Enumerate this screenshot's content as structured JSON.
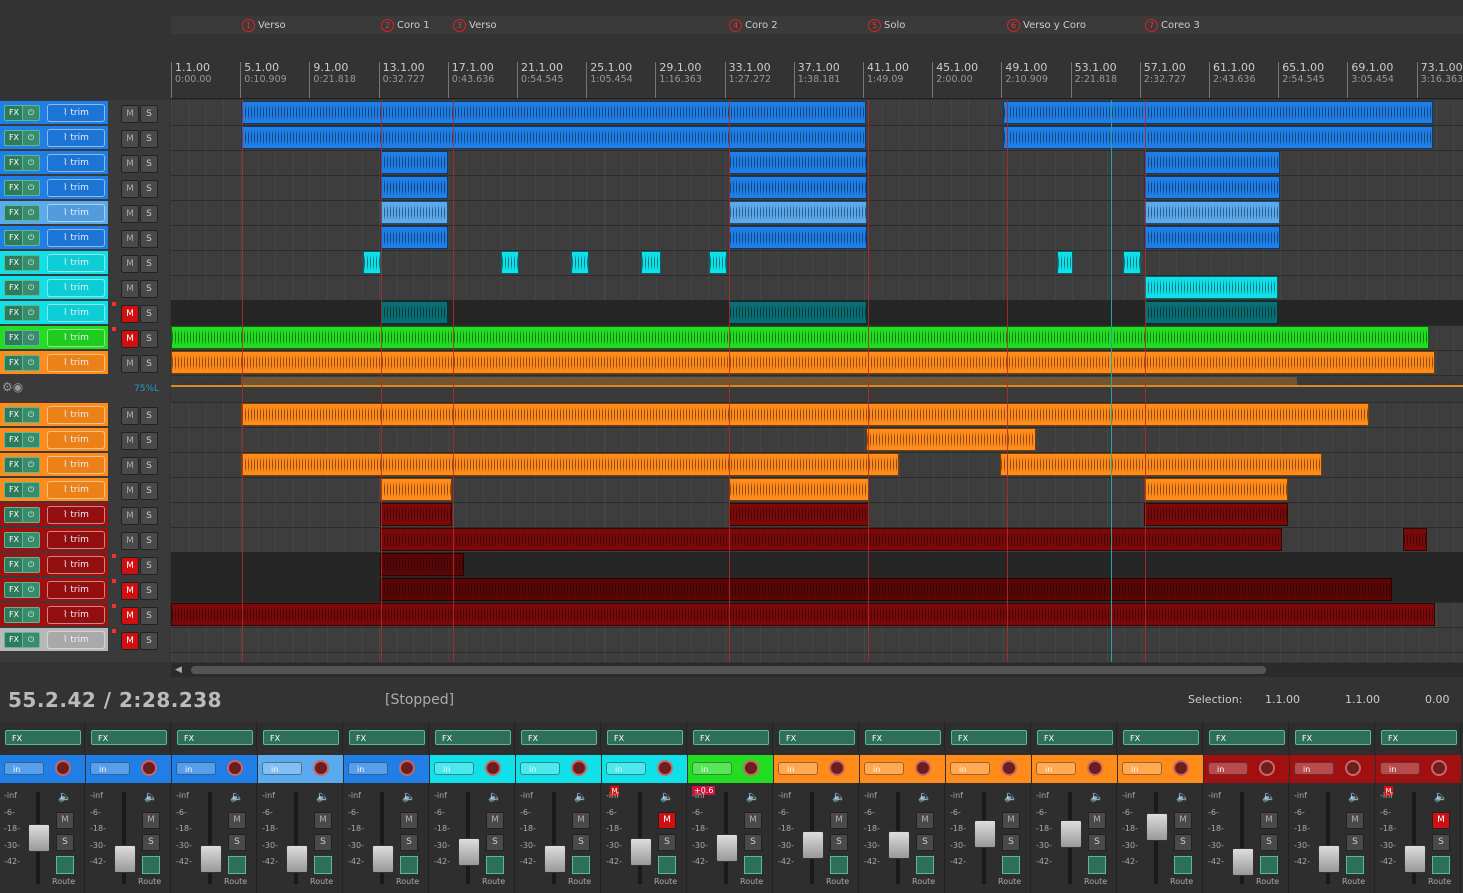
{
  "markers": [
    {
      "num": "1",
      "label": "Verso"
    },
    {
      "num": "2",
      "label": "Coro 1"
    },
    {
      "num": "3",
      "label": "Verso"
    },
    {
      "num": "4",
      "label": "Coro 2"
    },
    {
      "num": "5",
      "label": "Solo"
    },
    {
      "num": "6",
      "label": "Verso y Coro"
    },
    {
      "num": "7",
      "label": "Coreo 3"
    }
  ],
  "ruler": [
    {
      "bar": "1.1.00",
      "time": "0:00.00"
    },
    {
      "bar": "5.1.00",
      "time": "0:10.909"
    },
    {
      "bar": "9.1.00",
      "time": "0:21.818"
    },
    {
      "bar": "13.1.00",
      "time": "0:32.727"
    },
    {
      "bar": "17.1.00",
      "time": "0:43.636"
    },
    {
      "bar": "21.1.00",
      "time": "0:54.545"
    },
    {
      "bar": "25.1.00",
      "time": "1:05.454"
    },
    {
      "bar": "29.1.00",
      "time": "1:16.363"
    },
    {
      "bar": "33.1.00",
      "time": "1:27.272"
    },
    {
      "bar": "37.1.00",
      "time": "1:38.181"
    },
    {
      "bar": "41.1.00",
      "time": "1:49.09"
    },
    {
      "bar": "45.1.00",
      "time": "2:00.00"
    },
    {
      "bar": "49.1.00",
      "time": "2:10.909"
    },
    {
      "bar": "53.1.00",
      "time": "2:21.818"
    },
    {
      "bar": "57.1.00",
      "time": "2:32.727"
    },
    {
      "bar": "61.1.00",
      "time": "2:43.636"
    },
    {
      "bar": "65.1.00",
      "time": "2:54.545"
    },
    {
      "bar": "69.1.00",
      "time": "3:05.454"
    },
    {
      "bar": "73.1.00",
      "time": "3:16.363"
    }
  ],
  "track_labels": {
    "fx": "FX",
    "trim": "trim",
    "mute": "M",
    "solo": "S"
  },
  "envelope": {
    "pan_value": "75%L"
  },
  "tracks": [
    {
      "color": "#1f7fe6",
      "muted": false
    },
    {
      "color": "#1f7fe6",
      "muted": false
    },
    {
      "color": "#1f7fe6",
      "muted": false
    },
    {
      "color": "#1f7fe6",
      "muted": false
    },
    {
      "color": "#5aaaf0",
      "muted": false
    },
    {
      "color": "#1f7fe6",
      "muted": false
    },
    {
      "color": "#10e0e8",
      "muted": false
    },
    {
      "color": "#10e0e8",
      "muted": false
    },
    {
      "color": "#10e0e8",
      "muted": true
    },
    {
      "color": "#22dd22",
      "muted": true
    },
    {
      "color": "#ff8c1a",
      "muted": false
    },
    {
      "color": "#ff8c1a",
      "muted": false
    },
    {
      "color": "#ff8c1a",
      "muted": false
    },
    {
      "color": "#ff8c1a",
      "muted": false
    },
    {
      "color": "#ff8c1a",
      "muted": false
    },
    {
      "color": "#a01010",
      "muted": false
    },
    {
      "color": "#a01010",
      "muted": false
    },
    {
      "color": "#a01010",
      "muted": true
    },
    {
      "color": "#a01010",
      "muted": true
    },
    {
      "color": "#a01010",
      "muted": true
    },
    {
      "color": "#b8b8b8",
      "muted": true
    }
  ],
  "transport": {
    "position": "55.2.42 / 2:28.238",
    "state": "[Stopped]",
    "selection_label": "Selection:",
    "selection_start": "1.1.00",
    "selection_end": "1.1.00",
    "selection_length": "0.00"
  },
  "mixer": {
    "fx_label": "FX",
    "in_label": "in",
    "route_label": "Route",
    "scale": [
      "-inf",
      "-6-",
      "-18-",
      "-30-",
      "-42-"
    ],
    "mute_label": "M",
    "solo_label": "S",
    "strips": [
      {
        "color": "#1f7fe6",
        "muted": false,
        "badge": "",
        "fader": 0.55
      },
      {
        "color": "#1f7fe6",
        "muted": false,
        "badge": "",
        "fader": 0.25
      },
      {
        "color": "#1f7fe6",
        "muted": false,
        "badge": "",
        "fader": 0.25
      },
      {
        "color": "#5aaaf0",
        "muted": false,
        "badge": "",
        "fader": 0.25
      },
      {
        "color": "#1f7fe6",
        "muted": false,
        "badge": "",
        "fader": 0.25
      },
      {
        "color": "#10e0e8",
        "muted": false,
        "badge": "",
        "fader": 0.35
      },
      {
        "color": "#10e0e8",
        "muted": false,
        "badge": "",
        "fader": 0.25
      },
      {
        "color": "#10e0e8",
        "muted": true,
        "badge": "M",
        "fader": 0.35
      },
      {
        "color": "#22dd22",
        "muted": false,
        "badge": "+0.6",
        "fader": 0.4
      },
      {
        "color": "#ff8c1a",
        "muted": false,
        "badge": "",
        "fader": 0.45
      },
      {
        "color": "#ff8c1a",
        "muted": false,
        "badge": "",
        "fader": 0.45
      },
      {
        "color": "#ff8c1a",
        "muted": false,
        "badge": "",
        "fader": 0.6
      },
      {
        "color": "#ff8c1a",
        "muted": false,
        "badge": "",
        "fader": 0.6
      },
      {
        "color": "#ff8c1a",
        "muted": false,
        "badge": "",
        "fader": 0.7
      },
      {
        "color": "#a01010",
        "muted": false,
        "badge": "",
        "fader": 0.2
      },
      {
        "color": "#a01010",
        "muted": false,
        "badge": "",
        "fader": 0.25
      },
      {
        "color": "#a01010",
        "muted": true,
        "badge": "M",
        "fader": 0.25
      }
    ]
  }
}
